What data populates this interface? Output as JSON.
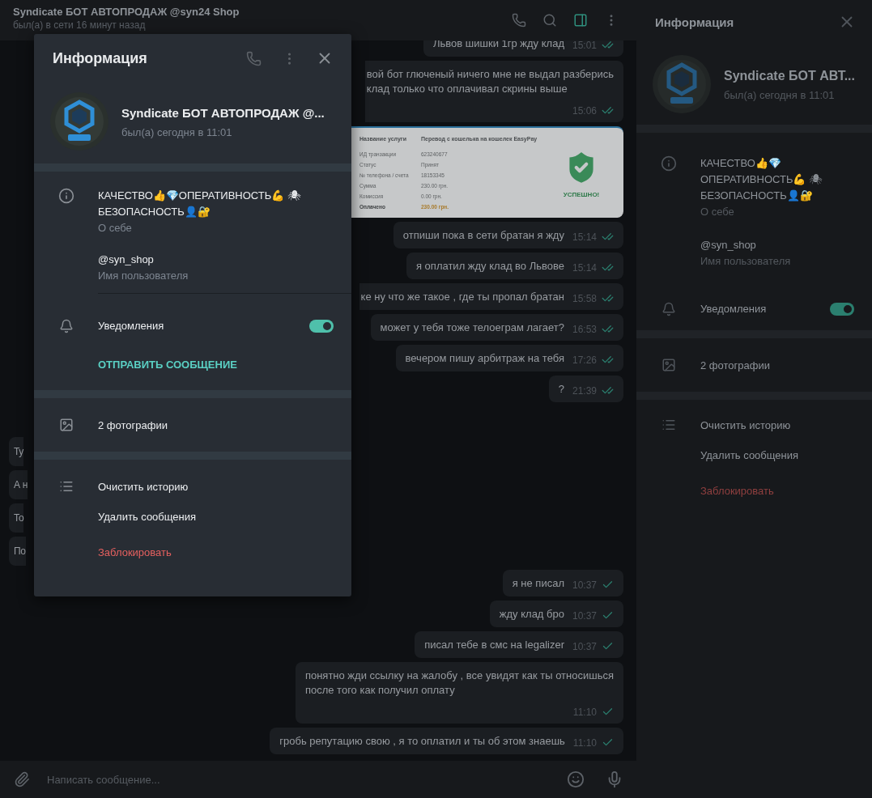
{
  "header": {
    "title": "Syndicate БОТ АВТОПРОДАЖ @syn24 Shop",
    "status": "был(а) в сети 16 минут назад",
    "panel_active": true
  },
  "messages": [
    {
      "kind": "out",
      "lines": [
        "Львов шишки 1гр жду клад"
      ],
      "time": "15:01",
      "read": true
    },
    {
      "kind": "out_cut",
      "lines": [
        "вой бот глюченый ничего мне не выдал разберись",
        "клад только что оплачивал скрины выше"
      ],
      "time": "15:06",
      "read": true
    },
    {
      "kind": "image",
      "receipt": {
        "heading_label": "Название услуги",
        "heading_value": "Перевод с кошелька на кошелек EasyPay",
        "rows": [
          {
            "label": "ИД транзакции",
            "value": "623240677",
            "total": false
          },
          {
            "label": "Статус",
            "value": "Принят",
            "total": false
          },
          {
            "label": "№ телефона / счета",
            "value": "18153345",
            "total": false
          },
          {
            "label": "Сумма",
            "value": "230.00 грн.",
            "total": false
          },
          {
            "label": "Комиссия",
            "value": "0.00 грн.",
            "total": false
          },
          {
            "label": "Оплачено",
            "value": "230.00 грн.",
            "total": true
          }
        ],
        "result": "УСПЕШНО!"
      }
    },
    {
      "kind": "out",
      "lines": [
        "отпиши пока в сети братан я жду"
      ],
      "time": "15:14",
      "read": true
    },
    {
      "kind": "out",
      "lines": [
        "я оплатил жду клад во Львове"
      ],
      "time": "15:14",
      "read": true
    },
    {
      "kind": "out_cut",
      "lines": [
        "ке ну что же такое , где ты пропал братан"
      ],
      "time": "15:58",
      "read": true
    },
    {
      "kind": "out",
      "lines": [
        "может у тебя тоже телоеграм лагает?"
      ],
      "time": "16:53",
      "read": true
    },
    {
      "kind": "out",
      "lines": [
        "вечером пишу арбитраж на тебя"
      ],
      "time": "17:26",
      "read": true
    },
    {
      "kind": "out",
      "lines": [
        "?"
      ],
      "time": "21:39",
      "read": true
    },
    {
      "kind": "in",
      "lines": [
        "Ту"
      ]
    },
    {
      "kind": "in",
      "lines": [
        "А н"
      ]
    },
    {
      "kind": "in",
      "lines": [
        "То"
      ]
    },
    {
      "kind": "in",
      "lines": [
        "По"
      ]
    },
    {
      "kind": "out",
      "lines": [
        "я не писал"
      ],
      "time": "10:37",
      "read": false
    },
    {
      "kind": "out",
      "lines": [
        "жду клад бро"
      ],
      "time": "10:37",
      "read": false
    },
    {
      "kind": "out",
      "lines": [
        "писал тебе в смс на legalizer"
      ],
      "time": "10:37",
      "read": false
    },
    {
      "kind": "out",
      "lines": [
        "понятно жди ссылку на жалобу , все увидят как ты относишься",
        "после того как получил оплату"
      ],
      "time": "11:10",
      "read": false
    },
    {
      "kind": "out",
      "lines": [
        "гробь репутацию свою , я то оплатил и ты об этом знаешь"
      ],
      "time": "11:10",
      "read": false
    }
  ],
  "composer": {
    "placeholder": "Написать сообщение..."
  },
  "side_panel": {
    "title": "Информация",
    "name": "Syndicate БОТ АВТ...",
    "status": "был(а) сегодня в 11:01",
    "bio": "КАЧЕСТВО👍💎ОПЕРАТИВНОСТЬ💪 🕷 БЕЗОПАСНОСТЬ👤🔐",
    "bio_label": "О себе",
    "username": "@syn_shop",
    "username_label": "Имя пользователя",
    "notifications": {
      "label": "Уведомления",
      "on": true
    },
    "photos": "2 фотографии",
    "actions": [
      {
        "label": "Очистить историю",
        "kind": "normal"
      },
      {
        "label": "Удалить сообщения",
        "kind": "normal"
      },
      {
        "label": "Заблокировать",
        "kind": "danger"
      }
    ]
  },
  "dialog": {
    "title": "Информация",
    "name": "Syndicate БОТ АВТОПРОДАЖ @...",
    "status": "был(а) сегодня в 11:01",
    "bio": "КАЧЕСТВО👍💎ОПЕРАТИВНОСТЬ💪 🕷 БЕЗОПАСНОСТЬ👤🔐",
    "bio_label": "О себе",
    "username": "@syn_shop",
    "username_label": "Имя пользователя",
    "notifications": {
      "label": "Уведомления",
      "on": true
    },
    "send_message": "ОТПРАВИТЬ СООБЩЕНИЕ",
    "photos": "2 фотографии",
    "actions": [
      {
        "label": "Очистить историю",
        "kind": "normal"
      },
      {
        "label": "Удалить сообщения",
        "kind": "normal"
      },
      {
        "label": "Заблокировать",
        "kind": "danger"
      }
    ]
  }
}
